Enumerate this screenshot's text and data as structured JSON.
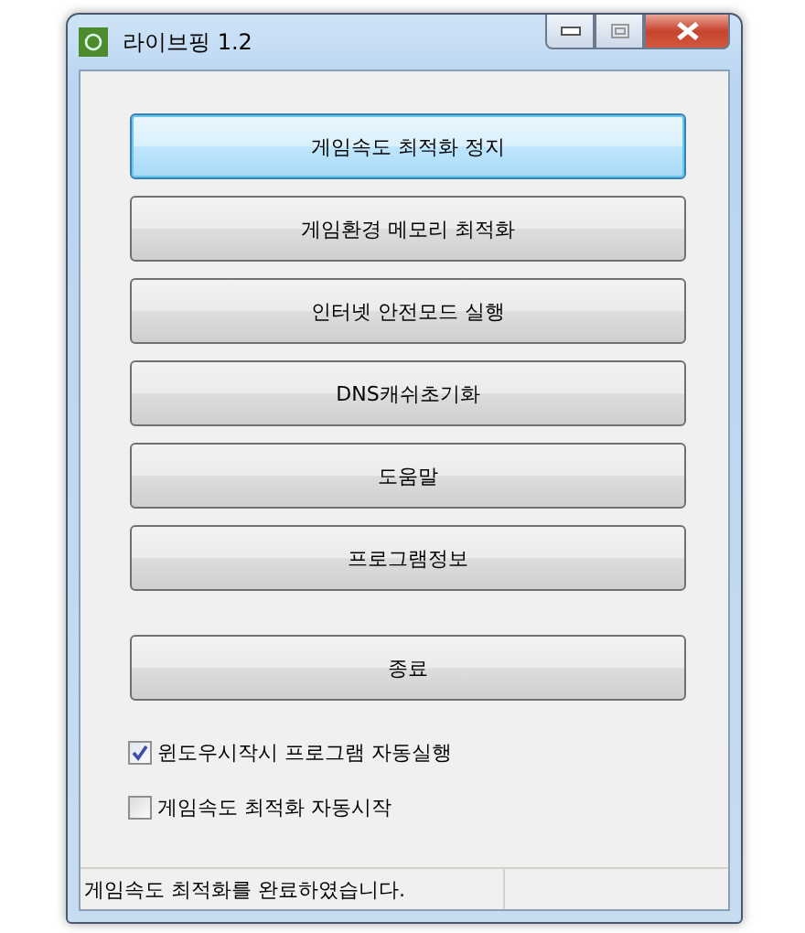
{
  "window": {
    "title": "라이브핑 1.2"
  },
  "buttons": [
    {
      "label": "게임속도 최적화 정지",
      "focused": true
    },
    {
      "label": "게임환경 메모리 최적화",
      "focused": false
    },
    {
      "label": "인터넷 안전모드 실행",
      "focused": false
    },
    {
      "label": "DNS캐쉬초기화",
      "focused": false
    },
    {
      "label": "도움말",
      "focused": false
    },
    {
      "label": "프로그램정보",
      "focused": false
    }
  ],
  "exit_button": {
    "label": "종료",
    "focused": false
  },
  "checkboxes": [
    {
      "label": "윈도우시작시 프로그램 자동실행",
      "checked": true
    },
    {
      "label": "게임속도 최적화 자동시작",
      "checked": false
    }
  ],
  "status_bar": {
    "message": "게임속도 최적화를 완료하였습니다."
  }
}
